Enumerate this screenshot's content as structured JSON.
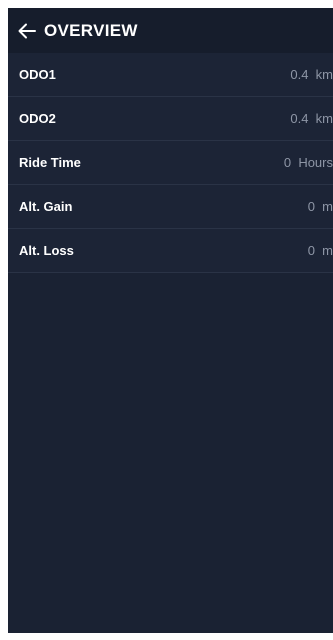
{
  "header": {
    "title": "OVERVIEW",
    "back_icon": "arrow-left-icon"
  },
  "stats": [
    {
      "label": "ODO1",
      "value": "0.4  km"
    },
    {
      "label": "ODO2",
      "value": "0.4  km"
    },
    {
      "label": "Ride Time",
      "value": "0  Hours"
    },
    {
      "label": "Alt. Gain",
      "value": "0  m"
    },
    {
      "label": "Alt. Loss",
      "value": "0  m"
    }
  ],
  "colors": {
    "background": "#1a2233",
    "app_bar": "#161d2c",
    "label_text": "#ffffff",
    "value_text": "#8e96a6",
    "divider": "#2a3346"
  }
}
